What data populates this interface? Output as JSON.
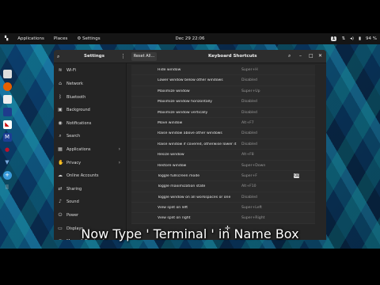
{
  "topbar": {
    "applications": "Applications",
    "places": "Places",
    "settings": "Settings",
    "clock": "Dec 29  22:06",
    "notification_count": "1",
    "battery": "94 %"
  },
  "window": {
    "sidebar_title": "Settings",
    "reset_label": "Reset All...",
    "title": "Keyboard Shortcuts"
  },
  "sidebar": {
    "items": [
      {
        "label": "Wi-Fi",
        "icon": "wifi-icon",
        "glyph": "≋"
      },
      {
        "label": "Network",
        "icon": "network-icon",
        "glyph": "⌂"
      },
      {
        "label": "Bluetooth",
        "icon": "bluetooth-icon",
        "glyph": "ᛒ"
      },
      {
        "label": "Background",
        "icon": "background-icon",
        "glyph": "▣"
      },
      {
        "label": "Notifications",
        "icon": "bell-icon",
        "glyph": "◉"
      },
      {
        "label": "Search",
        "icon": "search-icon",
        "glyph": "⌕"
      },
      {
        "label": "Applications",
        "icon": "grid-icon",
        "glyph": "▦",
        "chevron": "›"
      },
      {
        "label": "Privacy",
        "icon": "hand-icon",
        "glyph": "✋",
        "chevron": "›"
      },
      {
        "label": "Online Accounts",
        "icon": "cloud-icon",
        "glyph": "☁"
      },
      {
        "label": "Sharing",
        "icon": "share-icon",
        "glyph": "⇄"
      },
      {
        "label": "Sound",
        "icon": "speaker-icon",
        "glyph": "♪"
      },
      {
        "label": "Power",
        "icon": "power-icon",
        "glyph": "⏻"
      },
      {
        "label": "Displays",
        "icon": "display-icon",
        "glyph": "▭"
      },
      {
        "label": "Mouse & Touchpad",
        "icon": "mouse-icon",
        "glyph": "◎"
      }
    ]
  },
  "shortcuts": [
    {
      "name": "Hide window",
      "value": "Super+H"
    },
    {
      "name": "Lower window below other windows",
      "value": "Disabled"
    },
    {
      "name": "Maximize window",
      "value": "Super+Up"
    },
    {
      "name": "Maximize window horizontally",
      "value": "Disabled"
    },
    {
      "name": "Maximize window vertically",
      "value": "Disabled"
    },
    {
      "name": "Move window",
      "value": "Alt+F7"
    },
    {
      "name": "Raise window above other windows",
      "value": "Disabled"
    },
    {
      "name": "Raise window if covered, otherwise lower it",
      "value": "Disabled"
    },
    {
      "name": "Resize window",
      "value": "Alt+F8"
    },
    {
      "name": "Restore window",
      "value": "Super+Down"
    },
    {
      "name": "Toggle fullscreen mode",
      "value": "Super+F"
    },
    {
      "name": "Toggle maximization state",
      "value": "Alt+F10"
    },
    {
      "name": "Toggle window on all workspaces or one",
      "value": "Disabled"
    },
    {
      "name": "View split on left",
      "value": "Super+Left"
    },
    {
      "name": "View split on right",
      "value": "Super+Right"
    }
  ],
  "caption": "Now Type ' Terminal ' in Name Box"
}
